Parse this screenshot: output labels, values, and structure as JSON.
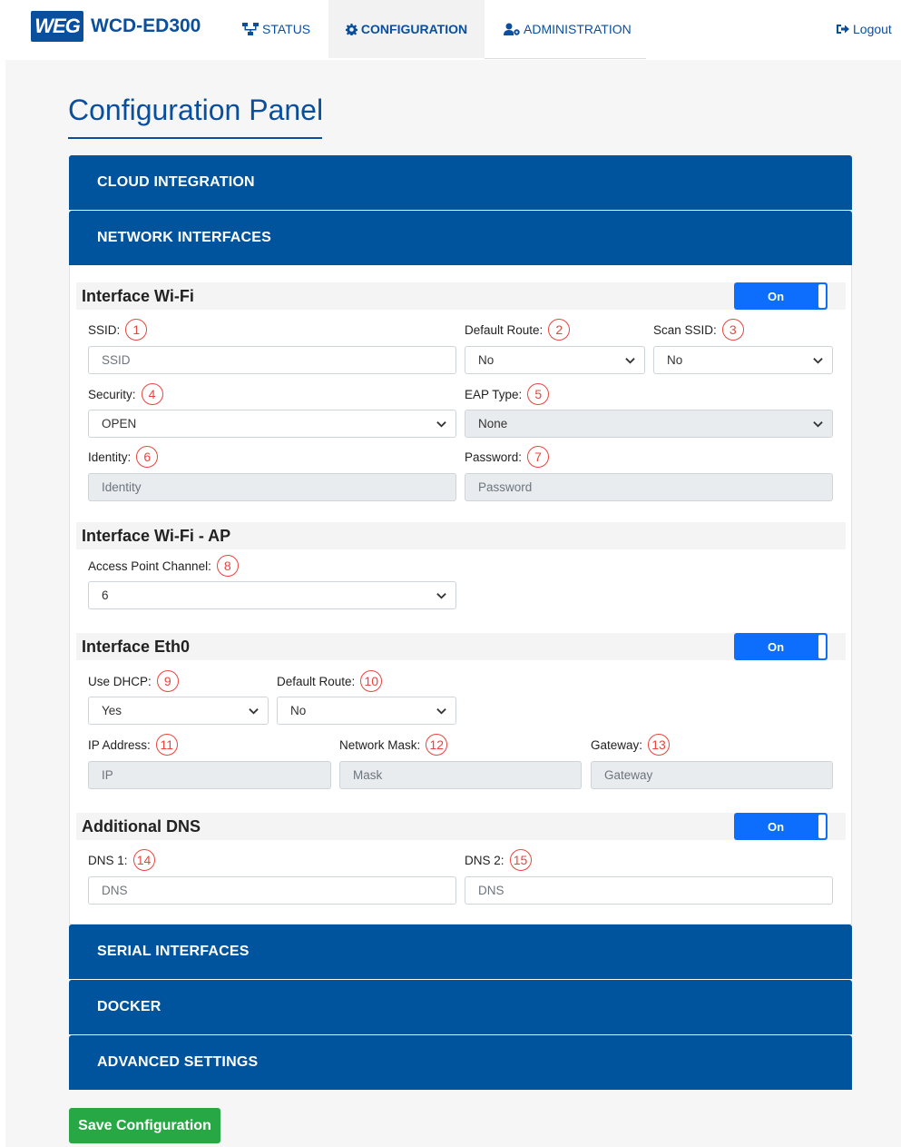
{
  "app": {
    "logo_text": "WEG",
    "product_name": "WCD-ED300"
  },
  "nav": {
    "status": "STATUS",
    "configuration": "CONFIGURATION",
    "administration": "ADMINISTRATION",
    "logout": "Logout"
  },
  "page": {
    "title": "Configuration Panel"
  },
  "accordion": {
    "cloud_integration": "CLOUD INTEGRATION",
    "network_interfaces": "NETWORK INTERFACES",
    "serial_interfaces": "SERIAL INTERFACES",
    "docker": "DOCKER",
    "advanced_settings": "ADVANCED SETTINGS"
  },
  "wifi": {
    "title": "Interface Wi-Fi",
    "toggle": "On",
    "ssid_label": "SSID:",
    "ssid_placeholder": "SSID",
    "default_route_label": "Default Route:",
    "default_route_value": "No",
    "scan_ssid_label": "Scan SSID:",
    "scan_ssid_value": "No",
    "security_label": "Security:",
    "security_value": "OPEN",
    "eap_type_label": "EAP Type:",
    "eap_type_value": "None",
    "identity_label": "Identity:",
    "identity_placeholder": "Identity",
    "password_label": "Password:",
    "password_placeholder": "Password"
  },
  "wifi_ap": {
    "title": "Interface Wi-Fi - AP",
    "channel_label": "Access Point Channel:",
    "channel_value": "6"
  },
  "eth0": {
    "title": "Interface Eth0",
    "toggle": "On",
    "dhcp_label": "Use DHCP:",
    "dhcp_value": "Yes",
    "default_route_label": "Default Route:",
    "default_route_value": "No",
    "ip_label": "IP Address:",
    "ip_placeholder": "IP",
    "mask_label": "Network Mask:",
    "mask_placeholder": "Mask",
    "gateway_label": "Gateway:",
    "gateway_placeholder": "Gateway"
  },
  "dns": {
    "title": "Additional DNS",
    "toggle": "On",
    "dns1_label": "DNS 1:",
    "dns1_placeholder": "DNS",
    "dns2_label": "DNS 2:",
    "dns2_placeholder": "DNS"
  },
  "annotations": [
    "1",
    "2",
    "3",
    "4",
    "5",
    "6",
    "7",
    "8",
    "9",
    "10",
    "11",
    "12",
    "13",
    "14",
    "15"
  ],
  "actions": {
    "save": "Save Configuration"
  },
  "colors": {
    "brand_blue": "#00549e",
    "toggle_blue": "#0d6efd",
    "save_green": "#28a745",
    "annotation_red": "#e8453c"
  }
}
